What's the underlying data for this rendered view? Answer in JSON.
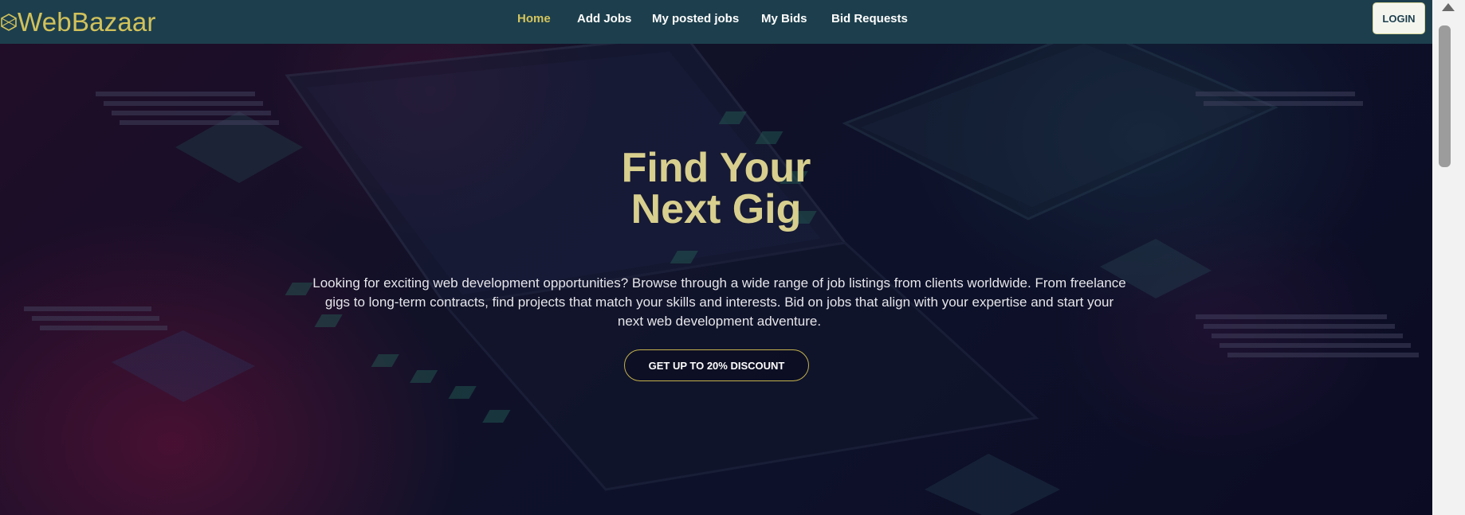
{
  "brand": {
    "name": "WebBazaar",
    "logo_icon": "hexagon-logo-icon",
    "color": "#d2c25b"
  },
  "nav": {
    "links": [
      {
        "label": "Home",
        "active": true
      },
      {
        "label": "Add Jobs",
        "active": false
      },
      {
        "label": "My posted jobs",
        "active": false
      },
      {
        "label": "My Bids",
        "active": false
      },
      {
        "label": "Bid Requests",
        "active": false
      }
    ],
    "login_label": "LOGIN"
  },
  "hero": {
    "title_line1": "Find Your",
    "title_line2": "Next Gig",
    "description": "Looking for exciting web development opportunities? Browse through a wide range of job listings from clients worldwide. From freelance gigs to long-term contracts, find projects that match your skills and interests. Bid on jobs that align with your expertise and start your next web development adventure.",
    "cta_label": "GET UP TO 20% DISCOUNT"
  },
  "colors": {
    "navbar_bg": "#1d3f4d",
    "accent": "#d4c45d",
    "title": "#d8cf8e"
  }
}
